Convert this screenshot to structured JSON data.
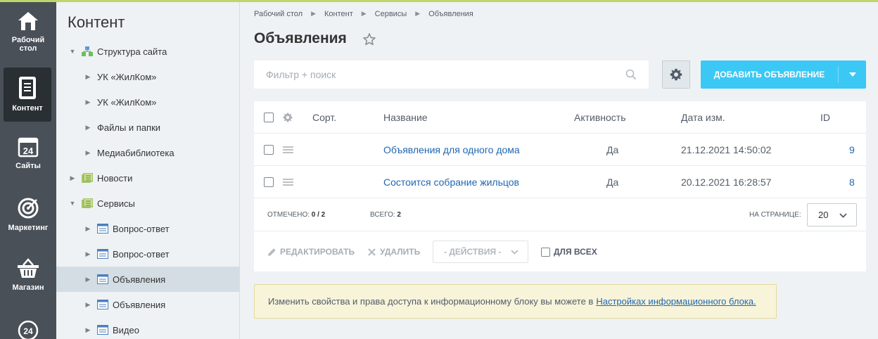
{
  "rail": {
    "items": [
      {
        "label": "Рабочий\nстол",
        "line1": "Рабочий",
        "line2": "стол"
      },
      {
        "label": "Контент"
      },
      {
        "label": "Сайты"
      },
      {
        "label": "Маркетинг"
      },
      {
        "label": "Магазин"
      }
    ]
  },
  "tree": {
    "title": "Контент",
    "items": [
      {
        "label": "Структура сайта"
      },
      {
        "label": "УК «ЖилКом»"
      },
      {
        "label": "УК «ЖилКом»"
      },
      {
        "label": "Файлы и папки"
      },
      {
        "label": "Медиабиблиотека"
      },
      {
        "label": "Новости"
      },
      {
        "label": "Сервисы"
      },
      {
        "label": "Вопрос-ответ"
      },
      {
        "label": "Вопрос-ответ"
      },
      {
        "label": "Объявления"
      },
      {
        "label": "Объявления"
      },
      {
        "label": "Видео"
      }
    ]
  },
  "breadcrumb": [
    "Рабочий стол",
    "Контент",
    "Сервисы",
    "Объявления"
  ],
  "page_title": "Объявления",
  "filter": {
    "placeholder": "Фильтр + поиск"
  },
  "add_button": {
    "label": "ДОБАВИТЬ ОБЪЯВЛЕНИЕ"
  },
  "table": {
    "columns": {
      "sort": "Сорт.",
      "name": "Название",
      "active": "Активность",
      "date": "Дата изм.",
      "id": "ID"
    },
    "rows": [
      {
        "name": "Объявления для одного дома",
        "active": "Да",
        "date": "21.12.2021 14:50:02",
        "id": "9"
      },
      {
        "name": "Состоится собрание жильцов",
        "active": "Да",
        "date": "20.12.2021 16:28:57",
        "id": "8"
      }
    ],
    "footer": {
      "checked_label": "ОТМЕЧЕНО:",
      "checked_value": "0 / 2",
      "total_label": "ВСЕГО:",
      "total_value": "2",
      "per_page_label": "НА СТРАНИЦЕ:",
      "per_page_value": "20"
    },
    "actions": {
      "edit": "РЕДАКТИРОВАТЬ",
      "delete": "УДАЛИТЬ",
      "actions_dd": "- ДЕЙСТВИЯ -",
      "for_all": "ДЛЯ ВСЕХ"
    }
  },
  "notice": {
    "text": "Изменить свойства и права доступа к информационному блоку вы можете в",
    "link": "Настройках информационного блока."
  },
  "colors": {
    "accent": "#3bc8f5",
    "link": "#2067b0",
    "rail": "#4a5058",
    "top_line": "#bfd66a"
  }
}
